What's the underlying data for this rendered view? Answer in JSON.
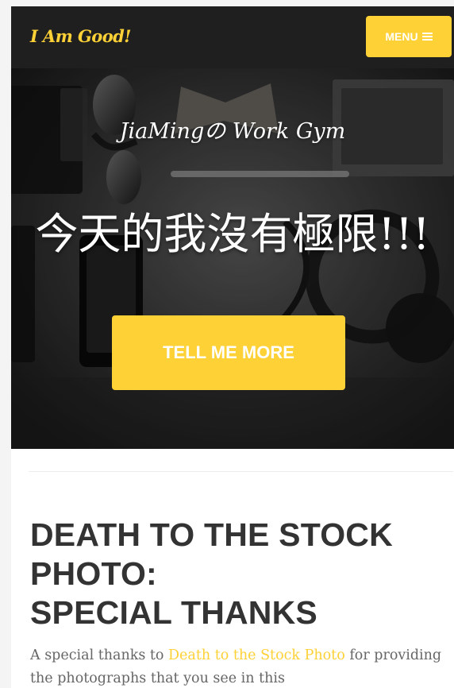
{
  "brand": {
    "name": "I Am Good!"
  },
  "nav": {
    "menu_label": "MENU",
    "menu_icon": "hamburger-icon"
  },
  "hero": {
    "subtitle": "JiaMingの Work Gym",
    "title": "今天的我沒有極限!!!",
    "cta_label": "TELL ME MORE"
  },
  "special_thanks": {
    "title_line_1": "DEATH TO THE STOCK",
    "title_line_2": "PHOTO:",
    "title_line_3": "SPECIAL THANKS",
    "text_before_link": "A special thanks to ",
    "link_text": "Death to the Stock Photo",
    "text_after_link": " for providing the photographs that you see in this"
  },
  "colors": {
    "accent": "#fed136",
    "navbar": "#1f1f1f",
    "heading": "#333333",
    "body_text": "#666666"
  }
}
